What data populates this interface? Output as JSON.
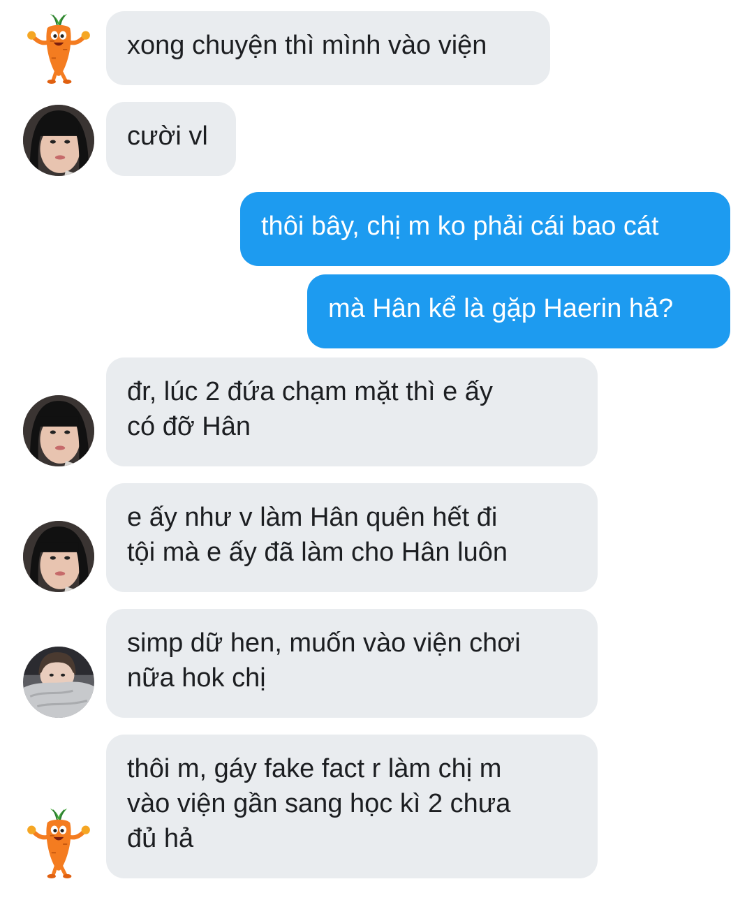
{
  "messages": [
    {
      "sender": "carrot",
      "direction": "in",
      "text": "xong chuyện thì mình vào viện"
    },
    {
      "sender": "girl-bangs",
      "direction": "in",
      "text": "cười vl"
    },
    {
      "sender": "me",
      "direction": "out",
      "text": "thôi bây, chị m ko phải cái bao cát"
    },
    {
      "sender": "me",
      "direction": "out",
      "text": "mà Hân kể là gặp Haerin hả?"
    },
    {
      "sender": "girl-bangs",
      "direction": "in",
      "text": "đr, lúc 2 đứa chạm mặt thì e ấy\ncó đỡ Hân"
    },
    {
      "sender": "girl-bangs",
      "direction": "in",
      "text": "e ấy như v làm Hân quên hết đi\ntội mà e ấy đã làm cho Hân luôn"
    },
    {
      "sender": "girl-blanket",
      "direction": "in",
      "text": "simp dữ hen, muốn vào viện chơi\nnữa hok chị"
    },
    {
      "sender": "carrot",
      "direction": "in",
      "text": "thôi m, gáy fake fact r làm chị m\nvào viện gần sang học kì 2 chưa\nđủ hả"
    }
  ],
  "avatars": {
    "carrot": "carrot-mascot-icon",
    "girl-bangs": "profile-photo-girl-bangs",
    "girl-blanket": "profile-photo-girl-blanket"
  },
  "colors": {
    "incoming_bubble": "#e9ecef",
    "outgoing_bubble": "#1d9bf0",
    "incoming_text": "#1c1e21",
    "outgoing_text": "#ffffff"
  }
}
